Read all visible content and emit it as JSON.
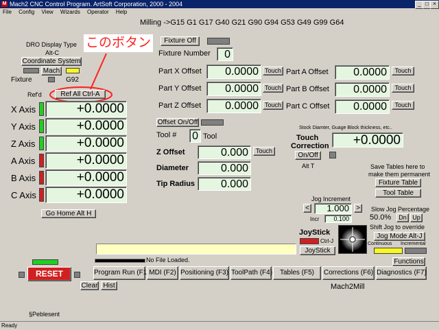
{
  "window": {
    "title": "Mach2 CNC Control Program. ArtSoft Corporation, 2000 - 2004",
    "icon_letter": "M",
    "minimize": "_",
    "maximize": "□",
    "close": "×"
  },
  "menu": [
    "File",
    "Config",
    "View",
    "Wizards",
    "Operator",
    "Help"
  ],
  "gcode_line": "Milling ->G15  G1 G17 G40 G21 G90 G94 G53 G49 G99 G64",
  "dro_panel": {
    "display_type_label": "DRO Display Type",
    "alt_c": "Alt-C",
    "coordinate_system": "Coordinate System",
    "mach": "Mach",
    "fixture": "Fixture",
    "g92": "G92",
    "refd": "Ref'd",
    "ref_all": "Ref All Ctrl-A",
    "go_home": "Go Home Alt H"
  },
  "annotation": {
    "text": "このボタン",
    "color": "#ff2020"
  },
  "axes": [
    {
      "label": "X Axis",
      "value": "+0.0000",
      "led": "green"
    },
    {
      "label": "Y Axis",
      "value": "+0.0000",
      "led": "green"
    },
    {
      "label": "Z Axis",
      "value": "+0.0000",
      "led": "green"
    },
    {
      "label": "A Axis",
      "value": "+0.0000",
      "led": "red"
    },
    {
      "label": "B Axis",
      "value": "+0.0000",
      "led": "red"
    },
    {
      "label": "C Axis",
      "value": "+0.0000",
      "led": "red"
    }
  ],
  "fixture": {
    "off_button": "Fixture Off",
    "number_label": "Fixture Number",
    "number_value": "0"
  },
  "offsets": [
    {
      "label": "Part X Offset",
      "value": "0.0000",
      "touch": "Touch"
    },
    {
      "label": "Part Y Offset",
      "value": "0.0000",
      "touch": "Touch"
    },
    {
      "label": "Part Z Offset",
      "value": "0.0000",
      "touch": "Touch"
    },
    {
      "label": "Part A Offset",
      "value": "0.0000",
      "touch": "Touch"
    },
    {
      "label": "Part B Offset",
      "value": "0.0000",
      "touch": "Touch"
    },
    {
      "label": "Part C Offset",
      "value": "0.0000",
      "touch": "Touch"
    }
  ],
  "tool": {
    "offset_onoff": "Offset On/Off",
    "tool_hash": "Tool #",
    "tool_num": "0",
    "tool_word": "Tool",
    "z_offset_label": "Z Offset",
    "z_offset_value": "0.000",
    "touch": "Touch",
    "diameter_label": "Diameter",
    "diameter_value": "0.000",
    "tip_radius_label": "Tip Radius",
    "tip_radius_value": "0.000"
  },
  "touch_correction": {
    "note": "Stock Diamter, Guage Block thickness, etc..",
    "label1": "Touch",
    "label2": "Correction",
    "value": "+0.0000",
    "onoff": "On/Off",
    "alt_t": "Alt T"
  },
  "tables": {
    "note1": "Save Tables here to",
    "note2": "make them permanent",
    "fixture_table": "Fixture Table",
    "tool_table": "Tool Table"
  },
  "jog": {
    "increment_label": "Jog Increment",
    "left": "<",
    "value": "1.000",
    "right": ">",
    "incr": "Incr",
    "incr_value": "0.100",
    "slow_label": "Slow Jog Percentage",
    "pct": "50.0%",
    "dn": "Dn",
    "up": "Up",
    "shift_note": "Shift Jog to override",
    "mode_button": "Jog Mode Alt-J",
    "continuous": "Continuous",
    "incremental": "Incremental"
  },
  "joystick": {
    "label": "JoyStick",
    "ctrlj": "Ctrl-J",
    "button": "JoyStick"
  },
  "status": {
    "file": "No File Loaded.",
    "reset": "RESET",
    "clear": "Clear",
    "hist": "Hist",
    "functions": "Functions",
    "mach2mill": "Mach2Mill",
    "pebles": "§Pebles",
    "ent": "ent",
    "ready": "Ready"
  },
  "tabs": [
    "Program Run (F1)",
    "MDI (F2)",
    "Positioning (F3)",
    "ToolPath (F4)",
    "Tables (F5)",
    "Corrections (F6)",
    "Diagnostics (F7)"
  ]
}
